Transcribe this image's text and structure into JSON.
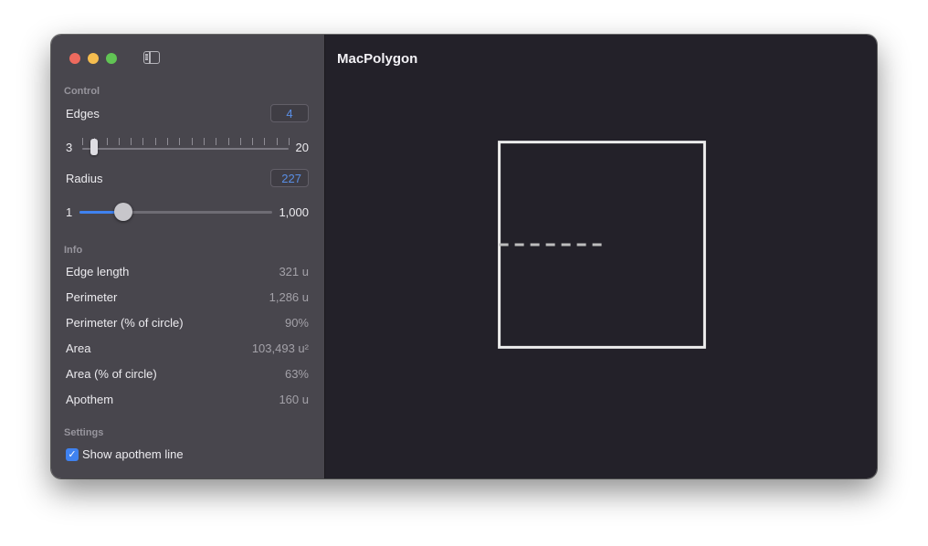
{
  "window": {
    "title": "MacPolygon",
    "icons": {
      "close": "close-icon",
      "minimize": "minimize-icon",
      "zoom": "zoom-icon",
      "sidebar_toggle": "sidebar-toggle-icon"
    }
  },
  "control": {
    "header": "Control",
    "edges": {
      "label": "Edges",
      "value": "4",
      "min_label": "3",
      "max_label": "20",
      "min": 3,
      "max": 20,
      "current": 4
    },
    "radius": {
      "label": "Radius",
      "value": "227",
      "min_label": "1",
      "max_label": "1,000",
      "min": 1,
      "max": 1000,
      "current": 227
    }
  },
  "info": {
    "header": "Info",
    "rows": [
      {
        "label": "Edge length",
        "value": "321 u"
      },
      {
        "label": "Perimeter",
        "value": "1,286 u"
      },
      {
        "label": "Perimeter (% of circle)",
        "value": "90%"
      },
      {
        "label": "Area",
        "value": "103,493 u²"
      },
      {
        "label": "Area (% of circle)",
        "value": "63%"
      },
      {
        "label": "Apothem",
        "value": "160 u"
      }
    ]
  },
  "settings": {
    "header": "Settings",
    "show_apothem": {
      "label": "Show apothem line",
      "checked": true
    }
  },
  "colors": {
    "accent": "#3f82f0",
    "polygon_stroke": "#ececec",
    "apothem_stroke": "#bdbdbd",
    "sidebar_bg": "#48464d",
    "content_bg": "#232129"
  }
}
